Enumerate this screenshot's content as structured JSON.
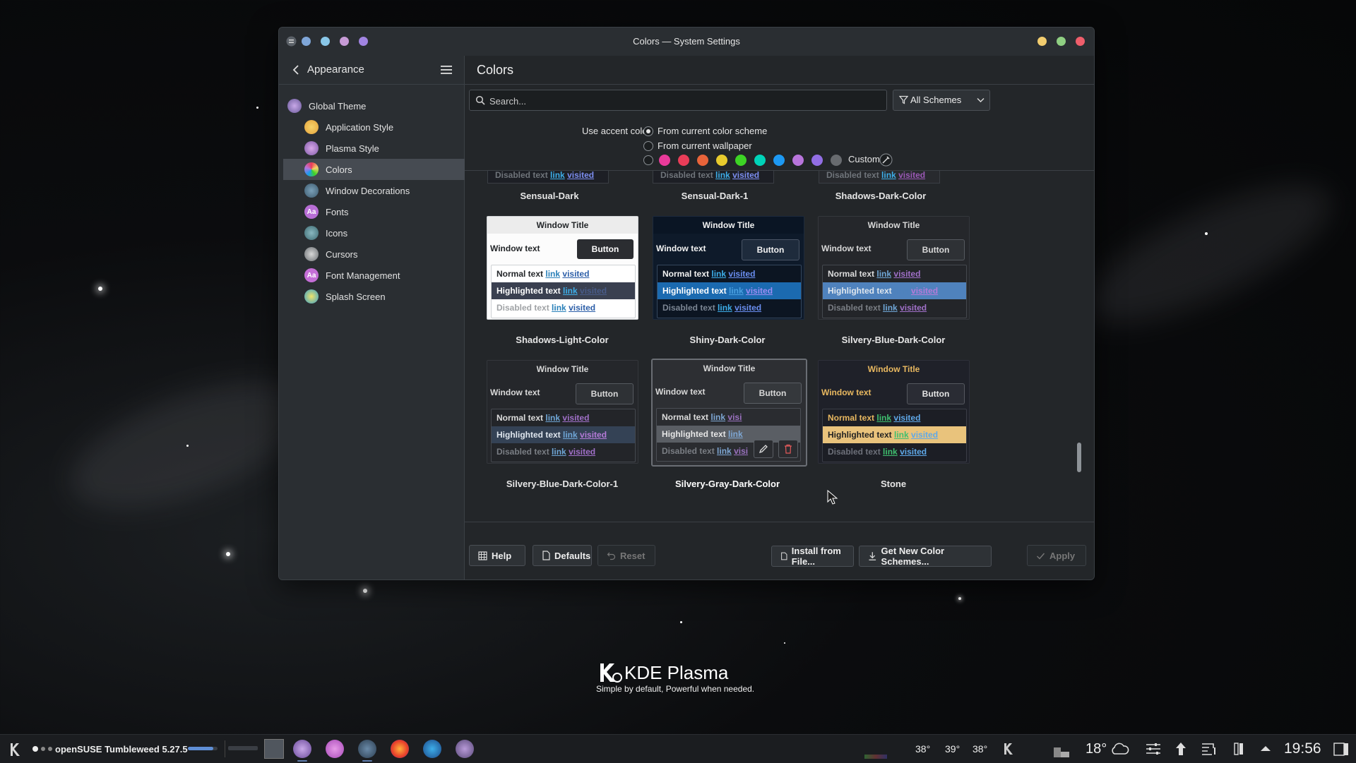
{
  "desktop": {
    "brand_name": "KDE Plasma",
    "tagline": "Simple by default, Powerful when  needed."
  },
  "window": {
    "title": "Colors — System Settings",
    "controls": [
      "minimize",
      "maximize",
      "close"
    ]
  },
  "sidebar": {
    "title": "Appearance",
    "items": [
      {
        "label": "Global Theme",
        "icon": "global-theme-icon"
      },
      {
        "label": "Application Style",
        "icon": "application-style-icon"
      },
      {
        "label": "Plasma Style",
        "icon": "plasma-style-icon"
      },
      {
        "label": "Colors",
        "icon": "colors-icon",
        "selected": true
      },
      {
        "label": "Window Decorations",
        "icon": "window-decorations-icon"
      },
      {
        "label": "Fonts",
        "icon": "fonts-icon",
        "glyph": "Aa"
      },
      {
        "label": "Icons",
        "icon": "icons-icon"
      },
      {
        "label": "Cursors",
        "icon": "cursors-icon"
      },
      {
        "label": "Font Management",
        "icon": "font-management-icon",
        "glyph": "Aa"
      },
      {
        "label": "Splash Screen",
        "icon": "splash-screen-icon"
      }
    ]
  },
  "main": {
    "title": "Colors",
    "search_placeholder": "Search...",
    "filter_label": "All Schemes",
    "accent": {
      "label": "Use accent color:",
      "option_scheme": "From current color scheme",
      "option_wallpaper": "From current wallpaper",
      "custom_label": "Custom:",
      "swatches": [
        "#e93a9a",
        "#e93d58",
        "#e9643a",
        "#e8cb2d",
        "#3dd425",
        "#00d3b8",
        "#1d99f3",
        "#b875dc",
        "#926ee4",
        "#686b6f"
      ]
    },
    "partial_row": {
      "disabled": "Disabled text",
      "link": "link",
      "visited": "visited"
    },
    "top_labels": [
      "Sensual-Dark",
      "Sensual-Dark-1",
      "Shadows-Dark-Color"
    ],
    "schemes": [
      {
        "name": "Shadows-Light-Color",
        "window_title": "Window Title",
        "window_text": "Window text",
        "button": "Button",
        "normal": "Normal text",
        "highlighted": "Highlighted text",
        "disabled": "Disabled text",
        "link": "link",
        "visited": "visited"
      },
      {
        "name": "Shiny-Dark-Color",
        "window_title": "Window Title",
        "window_text": "Window text",
        "button": "Button",
        "normal": "Normal text",
        "highlighted": "Highlighted text",
        "disabled": "Disabled text",
        "link": "link",
        "visited": "visited"
      },
      {
        "name": "Silvery-Blue-Dark-Color",
        "window_title": "Window Title",
        "window_text": "Window text",
        "button": "Button",
        "normal": "Normal text",
        "highlighted": "Highlighted text",
        "disabled": "Disabled text",
        "link": "link",
        "visited": "visited"
      },
      {
        "name": "Silvery-Blue-Dark-Color-1",
        "window_title": "Window Title",
        "window_text": "Window text",
        "button": "Button",
        "normal": "Normal text",
        "highlighted": "Highlighted text",
        "disabled": "Disabled text",
        "link": "link",
        "visited": "visited"
      },
      {
        "name": "Silvery-Gray-Dark-Color",
        "window_title": "Window Title",
        "window_text": "Window text",
        "button": "Button",
        "normal": "Normal text",
        "highlighted": "Highlighted text",
        "disabled": "Disabled text",
        "link": "link",
        "visited": "visi"
      },
      {
        "name": "Stone",
        "window_title": "Window Title",
        "window_text": "Window text",
        "button": "Button",
        "normal": "Normal text",
        "highlighted": "Highlighted text",
        "disabled": "Disabled text",
        "link": "link",
        "visited": "visited"
      }
    ],
    "install_label": "Install from File...",
    "get_new_label": "Get New Color Schemes...",
    "help_label": "Help",
    "defaults_label": "Defaults",
    "reset_label": "Reset",
    "apply_label": "Apply"
  },
  "taskbar": {
    "activity_label": "openSUSE Tumbleweed 5.27.5",
    "temps": [
      "38°",
      "39°",
      "38°"
    ],
    "weather_temp": "18°",
    "clock": "19:56"
  },
  "colors": {
    "window_bg": "#232629",
    "sidebar_bg": "#2a2e32",
    "selected_item": "#464b52",
    "link_blue": "#2980b9"
  }
}
